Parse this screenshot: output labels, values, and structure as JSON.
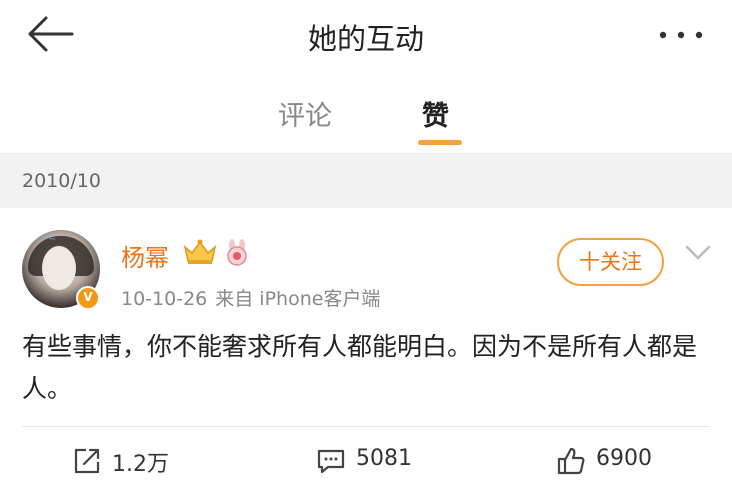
{
  "header": {
    "title": "她的互动",
    "back_icon": "back-arrow-icon",
    "more_icon": "more-icon"
  },
  "tabs": [
    {
      "label": "评论",
      "active": false
    },
    {
      "label": "赞",
      "active": true
    }
  ],
  "colors": {
    "accent": "#f6a040",
    "username": "#e8751a",
    "band": "#f2f2f2"
  },
  "date_group": "2010/10",
  "post": {
    "username": "杨幂",
    "badges": [
      "crown-icon",
      "bunny-icon"
    ],
    "verified_icon": "verified-badge-icon",
    "date": "10-10-26",
    "source": "来自 iPhone客户端",
    "follow_label": "十关注",
    "text": "有些事情，你不能奢求所有人都能明白。因为不是所有人都是人。",
    "actions": {
      "repost": {
        "icon": "repost-icon",
        "count": "1.2万"
      },
      "comment": {
        "icon": "comment-icon",
        "count": "5081"
      },
      "like": {
        "icon": "thumbs-up-icon",
        "count": "6900"
      }
    }
  }
}
